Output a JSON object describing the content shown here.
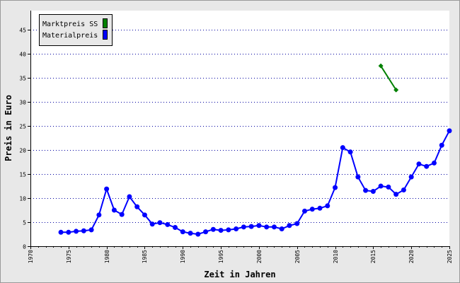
{
  "chart_data": {
    "type": "line",
    "xlabel": "Zeit in Jahren",
    "ylabel": "Preis in Euro",
    "xlim": [
      1970,
      2025
    ],
    "ylim": [
      0,
      49
    ],
    "x_ticks": [
      1970,
      1975,
      1980,
      1985,
      1990,
      1995,
      2000,
      2005,
      2010,
      2015,
      2020,
      2025
    ],
    "y_ticks": [
      0,
      5,
      10,
      15,
      20,
      25,
      30,
      35,
      40,
      45
    ],
    "grid": "horizontal dotted",
    "legend_position": "top-left",
    "series": [
      {
        "name": "Marktpreis SS",
        "color": "#008000",
        "marker": "diamond",
        "points": [
          [
            2016,
            37.5
          ],
          [
            2018,
            32.5
          ]
        ]
      },
      {
        "name": "Materialpreis",
        "color": "#0000ff",
        "marker": "circle",
        "points": [
          [
            1974,
            2.9
          ],
          [
            1975,
            2.9
          ],
          [
            1976,
            3.1
          ],
          [
            1977,
            3.2
          ],
          [
            1978,
            3.4
          ],
          [
            1979,
            6.5
          ],
          [
            1980,
            11.9
          ],
          [
            1981,
            7.5
          ],
          [
            1982,
            6.6
          ],
          [
            1983,
            10.3
          ],
          [
            1984,
            8.2
          ],
          [
            1985,
            6.5
          ],
          [
            1986,
            4.6
          ],
          [
            1987,
            4.9
          ],
          [
            1988,
            4.5
          ],
          [
            1989,
            3.9
          ],
          [
            1990,
            3.0
          ],
          [
            1991,
            2.7
          ],
          [
            1992,
            2.5
          ],
          [
            1993,
            3.0
          ],
          [
            1994,
            3.5
          ],
          [
            1995,
            3.3
          ],
          [
            1996,
            3.4
          ],
          [
            1997,
            3.6
          ],
          [
            1998,
            4.0
          ],
          [
            1999,
            4.1
          ],
          [
            2000,
            4.3
          ],
          [
            2001,
            4.0
          ],
          [
            2002,
            4.0
          ],
          [
            2003,
            3.6
          ],
          [
            2004,
            4.3
          ],
          [
            2005,
            4.7
          ],
          [
            2006,
            7.3
          ],
          [
            2007,
            7.7
          ],
          [
            2008,
            7.9
          ],
          [
            2009,
            8.4
          ],
          [
            2010,
            12.2
          ],
          [
            2011,
            20.5
          ],
          [
            2012,
            19.6
          ],
          [
            2013,
            14.4
          ],
          [
            2014,
            11.6
          ],
          [
            2015,
            11.4
          ],
          [
            2016,
            12.5
          ],
          [
            2017,
            12.3
          ],
          [
            2018,
            10.8
          ],
          [
            2019,
            11.7
          ],
          [
            2020,
            14.4
          ],
          [
            2021,
            17.1
          ],
          [
            2022,
            16.6
          ],
          [
            2023,
            17.3
          ],
          [
            2024,
            21.0
          ],
          [
            2025,
            24.0
          ]
        ]
      }
    ]
  }
}
